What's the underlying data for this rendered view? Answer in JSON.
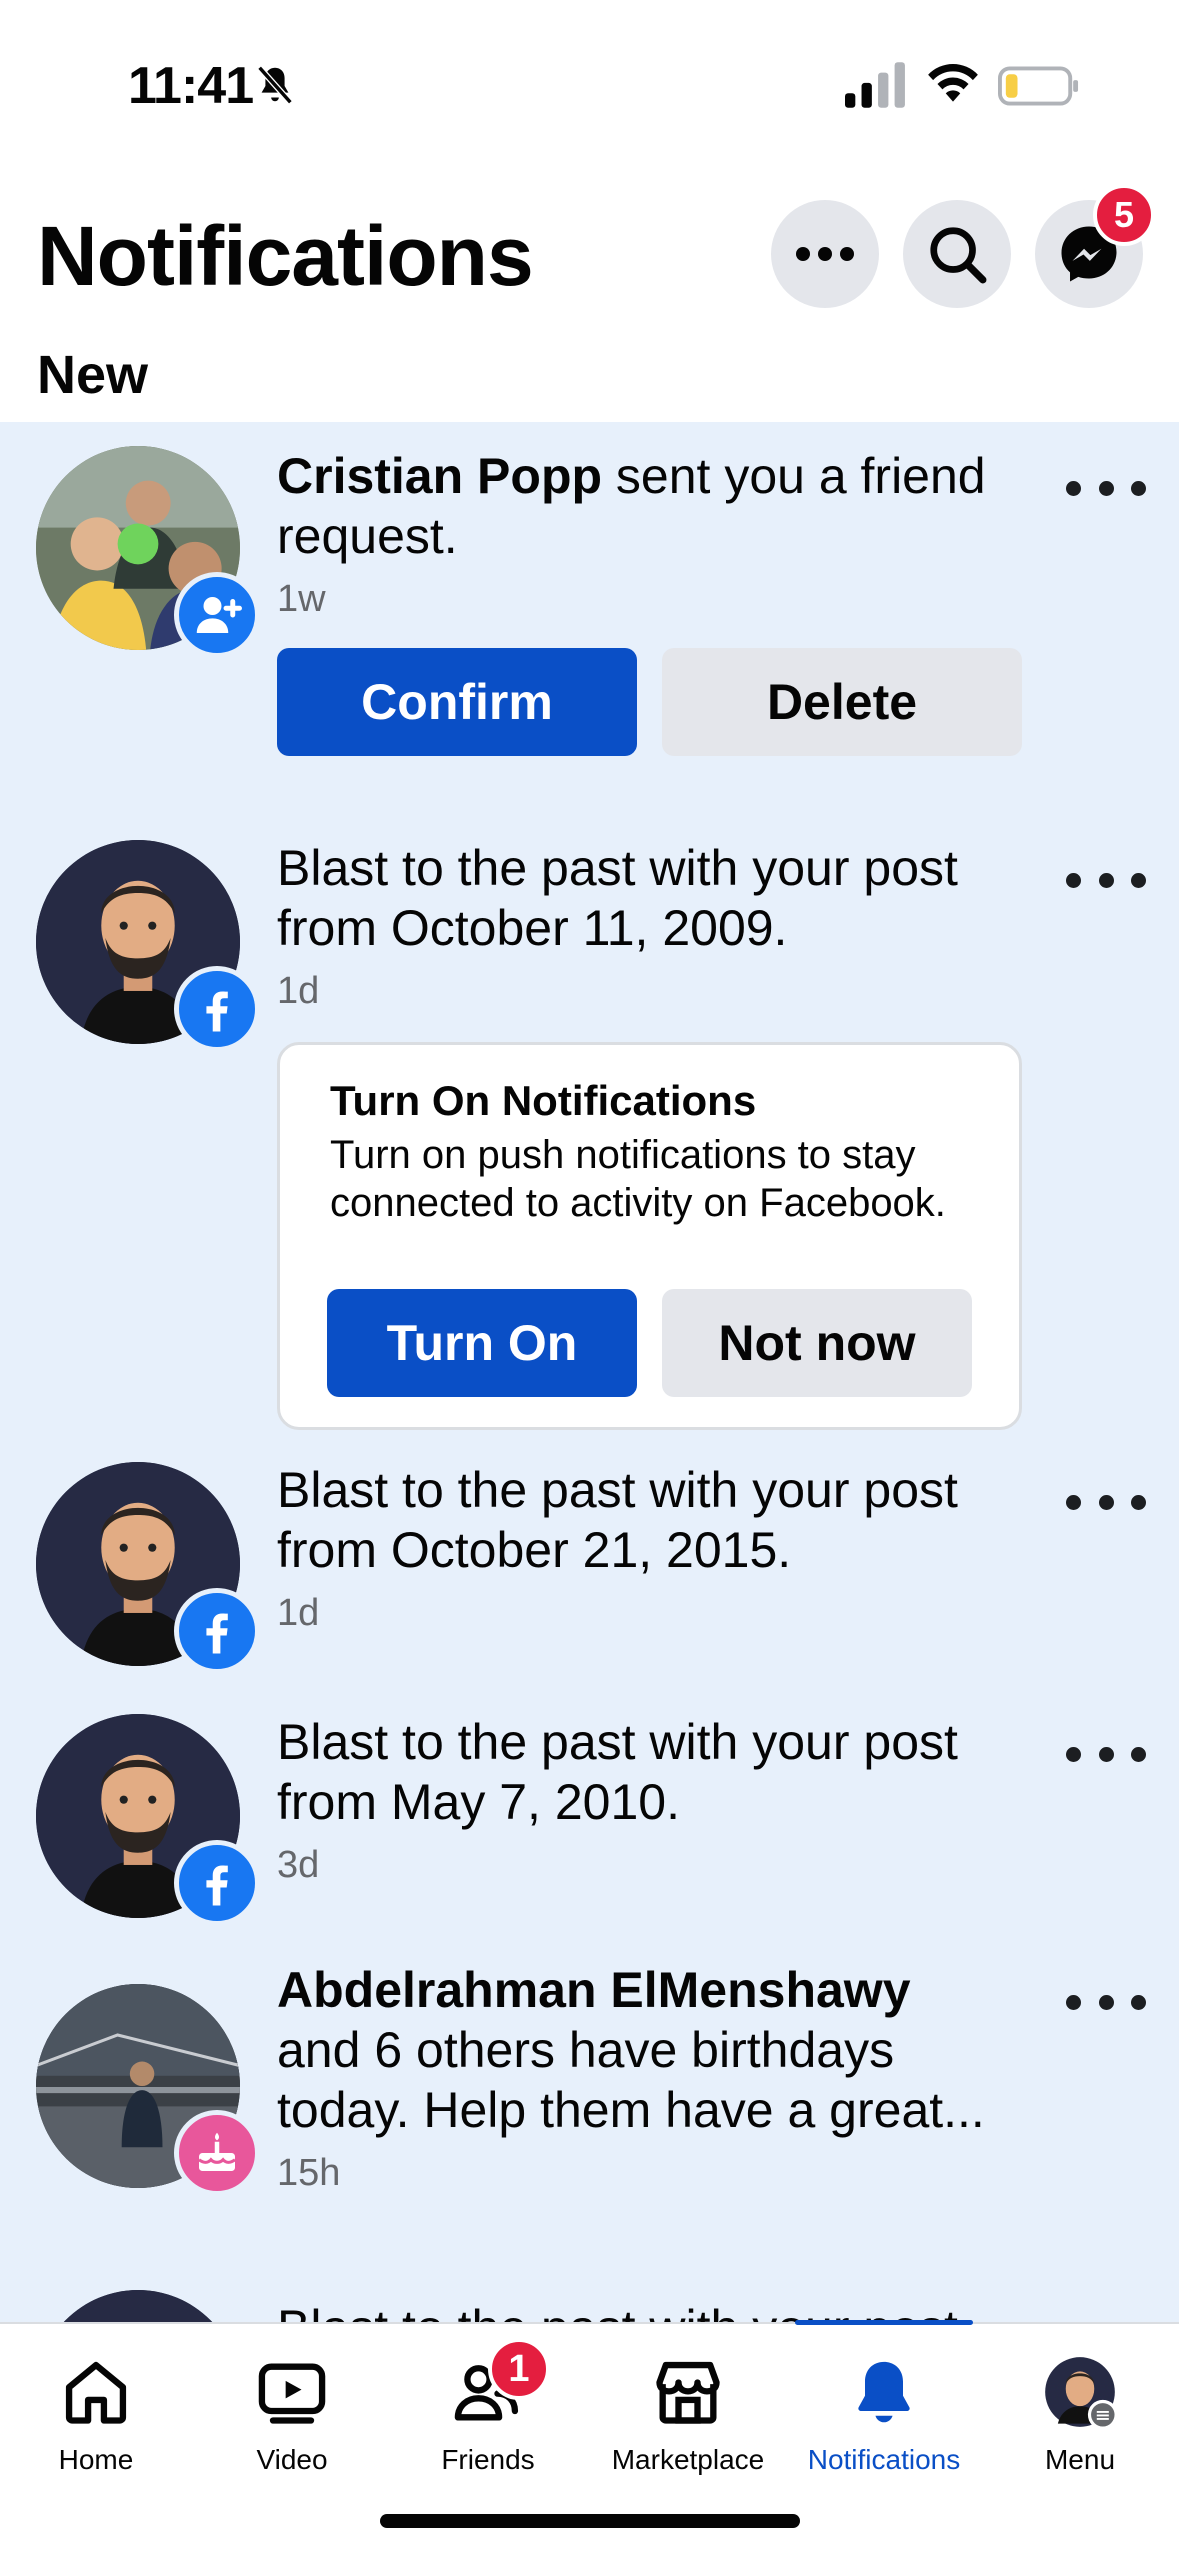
{
  "status_bar": {
    "time": "11:41"
  },
  "header": {
    "title": "Notifications",
    "messenger_badge": "5"
  },
  "section": {
    "new_label": "New"
  },
  "notifications": [
    {
      "name": "Cristian Popp",
      "text": " sent you a friend request.",
      "time": "1w",
      "confirm_label": "Confirm",
      "delete_label": "Delete"
    },
    {
      "text": "Blast to the past with your post from October 11, 2009.",
      "time": "1d"
    },
    {
      "text": "Blast to the past with your post from October 21, 2015.",
      "time": "1d"
    },
    {
      "text": "Blast to the past with your post from May 7, 2010.",
      "time": "3d"
    },
    {
      "name": "Abdelrahman ElMenshawy",
      "text": " and 6 others have birthdays today. Help them have a great...",
      "time": "15h"
    },
    {
      "text": "Blast to the past with your post"
    }
  ],
  "prompt": {
    "title": "Turn On Notifications",
    "body": "Turn on push notifications to stay connected to activity on Facebook.",
    "turn_on_label": "Turn On",
    "not_now_label": "Not now"
  },
  "tabs": [
    {
      "label": "Home"
    },
    {
      "label": "Video"
    },
    {
      "label": "Friends",
      "badge": "1"
    },
    {
      "label": "Marketplace"
    },
    {
      "label": "Notifications"
    },
    {
      "label": "Menu"
    }
  ],
  "colors": {
    "accent": "#0a4fc6",
    "unread_bg": "#e7f0fb",
    "badge_red": "#e41e3f",
    "birthday_pink": "#e8579b"
  }
}
